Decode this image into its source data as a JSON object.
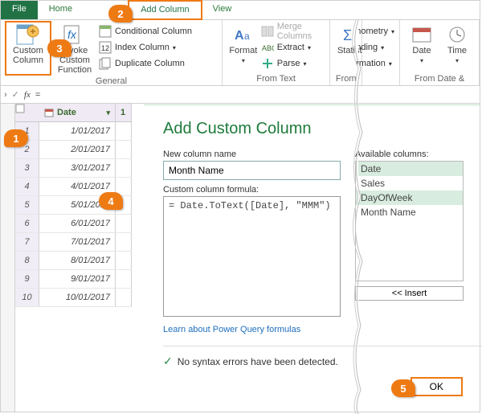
{
  "tabs": {
    "file": "File",
    "home": "Home",
    "add_column": "Add Column",
    "view": "View"
  },
  "ribbon": {
    "custom_column": "Custom\nColumn",
    "invoke": "Invoke Custom\nFunction",
    "conditional": "Conditional Column",
    "index": "Index Column",
    "duplicate": "Duplicate Column",
    "general": "General",
    "format": "Format",
    "merge": "Merge Columns",
    "extract": "Extract",
    "parse": "Parse",
    "from_text": "From Text",
    "stats": "Statist",
    "from_num": "From",
    "nom": "nometry",
    "nding": "nding",
    "rmation": "rmation",
    "date": "Date",
    "time": "Time",
    "from_dt": "From Date &"
  },
  "fx": "=",
  "grid": {
    "date_hdr": "Date",
    "col2_hdr": "1",
    "rows": [
      {
        "n": "1",
        "d": "1/01/2017"
      },
      {
        "n": "2",
        "d": "2/01/2017"
      },
      {
        "n": "3",
        "d": "3/01/2017"
      },
      {
        "n": "4",
        "d": "4/01/2017"
      },
      {
        "n": "5",
        "d": "5/01/2017"
      },
      {
        "n": "6",
        "d": "6/01/2017"
      },
      {
        "n": "7",
        "d": "7/01/2017"
      },
      {
        "n": "8",
        "d": "8/01/2017"
      },
      {
        "n": "9",
        "d": "9/01/2017"
      },
      {
        "n": "10",
        "d": "10/01/2017"
      }
    ]
  },
  "dialog": {
    "title": "Add Custom Column",
    "new_col_lbl": "New column name",
    "new_col_val": "Month Name",
    "formula_lbl": "Custom column formula:",
    "formula_val": "= Date.ToText([Date], \"MMM\")",
    "avail_lbl": "Available columns:",
    "cols": [
      "Date",
      "Sales",
      "DayOfWeek",
      "Month Name"
    ],
    "insert": "<< Insert",
    "learn": "Learn about Power Query formulas",
    "status": "No syntax errors have been detected.",
    "ok": "OK"
  },
  "callouts": {
    "c1": "1",
    "c2": "2",
    "c3": "3",
    "c4": "4",
    "c5": "5"
  }
}
